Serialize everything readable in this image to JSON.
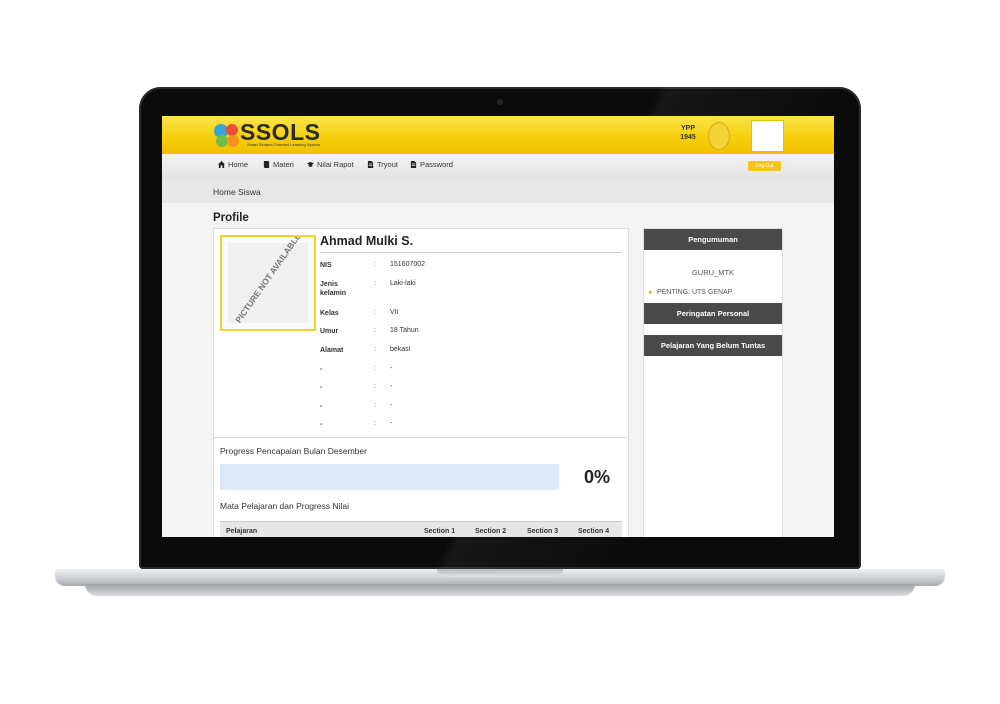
{
  "brand": {
    "logo_text": "SSOLS",
    "logo_subtitle": "Smart Student Oriented Learning System",
    "partner_text": "YPP",
    "partner_year": "1945"
  },
  "nav": {
    "items": [
      {
        "label": "Home",
        "icon": "home-icon"
      },
      {
        "label": "Materi",
        "icon": "book-icon"
      },
      {
        "label": "Nilai Rapot",
        "icon": "graduation-cap-icon"
      },
      {
        "label": "Tryout",
        "icon": "document-icon"
      },
      {
        "label": "Password",
        "icon": "document-icon"
      }
    ],
    "logout_label": "Log Out"
  },
  "breadcrumb": "Home Siswa",
  "profile": {
    "title": "Profile",
    "photo_placeholder": "PICTURE NOT AVAILABLE",
    "name": "Ahmad Mulki S.",
    "fields": [
      {
        "label": "NIS",
        "value": "151607002"
      },
      {
        "label": "Jenis kelamin",
        "value": "Laki-laki"
      },
      {
        "label": "Kelas",
        "value": "VII"
      },
      {
        "label": "Umur",
        "value": "18 Tahun"
      },
      {
        "label": "Alamat",
        "value": "bekasi"
      },
      {
        "label": "-",
        "value": "-"
      },
      {
        "label": "-",
        "value": "-"
      },
      {
        "label": "-",
        "value": "-"
      },
      {
        "label": "-",
        "value": "-"
      }
    ]
  },
  "progress": {
    "title": "Progress Pencapaian Bulan Desember",
    "percent": 0,
    "percent_label": "0%"
  },
  "subjects": {
    "title": "Mata Pelajaran dan Progress Nilai",
    "columns": [
      "Pelajaran",
      "Section 1",
      "Section 2",
      "Section 3",
      "Section 4"
    ]
  },
  "sidebar": {
    "announcement_header": "Pengumuman",
    "announcement_user": "GURU_MTK",
    "announcement_item": "PENTING: UTS GENAP",
    "warning_header": "Peringatan Personal",
    "incomplete_header": "Pelajaran Yang Belum Tuntas"
  },
  "colors": {
    "brand_yellow": "#f6cf0c",
    "dark_header": "#4a4a4a",
    "progress_track": "#dbe9f8"
  }
}
